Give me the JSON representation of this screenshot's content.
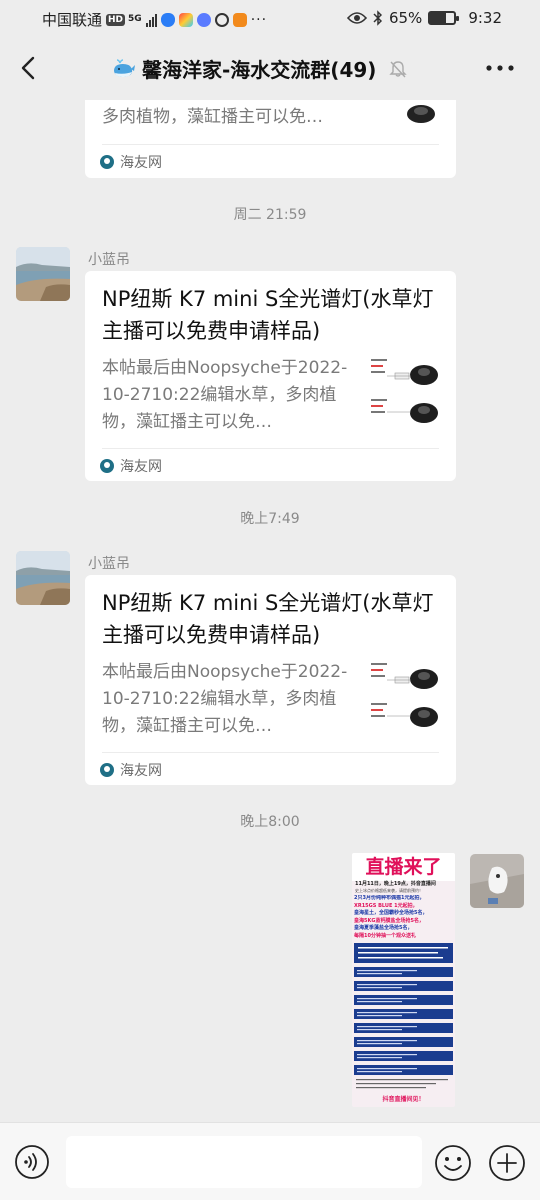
{
  "status_bar": {
    "carrier": "中国联通",
    "network_badge": "HD",
    "network_type": "5G",
    "battery_text": "65%",
    "battery_level": 0.65,
    "time": "9:32"
  },
  "header": {
    "title": "馨海洋家-海水交流群(49)",
    "title_icon": "whale-emoji-icon",
    "muted_icon": "bell-off-icon"
  },
  "messages": [
    {
      "type": "link_card",
      "partial": true,
      "desc_line": "多肉植物，藻缸播主可以免…",
      "source": "海友网"
    },
    {
      "time": "周二 21:59"
    },
    {
      "type": "link_card",
      "sender": "小蓝吊",
      "title": "NP纽斯 K7 mini S全光谱灯(水草灯主播可以免费申请样品)",
      "desc": "本帖最后由Noopsyche于2022-10-2710:22编辑水草，多肉植物，藻缸播主可以免…",
      "source": "海友网"
    },
    {
      "time": "晚上7:49"
    },
    {
      "type": "link_card",
      "sender": "小蓝吊",
      "title": "NP纽斯 K7 mini S全光谱灯(水草灯主播可以免费申请样品)",
      "desc": "本帖最后由Noopsyche于2022-10-2710:22编辑水草，多肉植物，藻缸播主可以免…",
      "source": "海友网"
    },
    {
      "time": "晚上8:00"
    },
    {
      "type": "image",
      "from_self": true,
      "poster": {
        "headline": "直播来了",
        "intro": "11月11日，晚上19点，抖音直播间",
        "intro2": "史上冰点价格超低来袭，请提前预约！",
        "promo_lines": [
          "2只3月份纯种布偶猫1元起拍，",
          "XR15GS BLUE 1元起拍，",
          "皇海星土，全国霸秒全场抢5名，",
          "皇海5KG蓝钙膜盐全场抢5名，",
          "皇海夏季藻盐全场抢5名，",
          "每隔10分钟抽一个观众送礼"
        ],
        "footer": "抖音直播间见！"
      }
    }
  ],
  "input_bar": {
    "placeholder": ""
  }
}
